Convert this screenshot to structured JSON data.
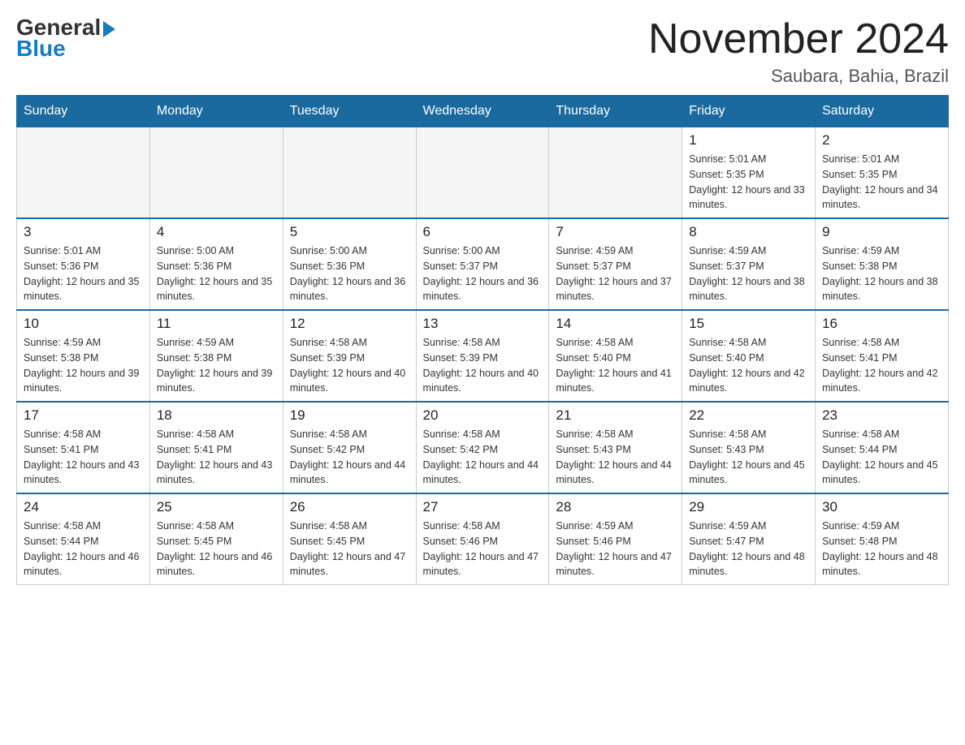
{
  "header": {
    "logo_general": "General",
    "logo_blue": "Blue",
    "title": "November 2024",
    "location": "Saubara, Bahia, Brazil"
  },
  "days_of_week": [
    "Sunday",
    "Monday",
    "Tuesday",
    "Wednesday",
    "Thursday",
    "Friday",
    "Saturday"
  ],
  "weeks": [
    [
      {
        "day": "",
        "sunrise": "",
        "sunset": "",
        "daylight": ""
      },
      {
        "day": "",
        "sunrise": "",
        "sunset": "",
        "daylight": ""
      },
      {
        "day": "",
        "sunrise": "",
        "sunset": "",
        "daylight": ""
      },
      {
        "day": "",
        "sunrise": "",
        "sunset": "",
        "daylight": ""
      },
      {
        "day": "",
        "sunrise": "",
        "sunset": "",
        "daylight": ""
      },
      {
        "day": "1",
        "sunrise": "Sunrise: 5:01 AM",
        "sunset": "Sunset: 5:35 PM",
        "daylight": "Daylight: 12 hours and 33 minutes."
      },
      {
        "day": "2",
        "sunrise": "Sunrise: 5:01 AM",
        "sunset": "Sunset: 5:35 PM",
        "daylight": "Daylight: 12 hours and 34 minutes."
      }
    ],
    [
      {
        "day": "3",
        "sunrise": "Sunrise: 5:01 AM",
        "sunset": "Sunset: 5:36 PM",
        "daylight": "Daylight: 12 hours and 35 minutes."
      },
      {
        "day": "4",
        "sunrise": "Sunrise: 5:00 AM",
        "sunset": "Sunset: 5:36 PM",
        "daylight": "Daylight: 12 hours and 35 minutes."
      },
      {
        "day": "5",
        "sunrise": "Sunrise: 5:00 AM",
        "sunset": "Sunset: 5:36 PM",
        "daylight": "Daylight: 12 hours and 36 minutes."
      },
      {
        "day": "6",
        "sunrise": "Sunrise: 5:00 AM",
        "sunset": "Sunset: 5:37 PM",
        "daylight": "Daylight: 12 hours and 36 minutes."
      },
      {
        "day": "7",
        "sunrise": "Sunrise: 4:59 AM",
        "sunset": "Sunset: 5:37 PM",
        "daylight": "Daylight: 12 hours and 37 minutes."
      },
      {
        "day": "8",
        "sunrise": "Sunrise: 4:59 AM",
        "sunset": "Sunset: 5:37 PM",
        "daylight": "Daylight: 12 hours and 38 minutes."
      },
      {
        "day": "9",
        "sunrise": "Sunrise: 4:59 AM",
        "sunset": "Sunset: 5:38 PM",
        "daylight": "Daylight: 12 hours and 38 minutes."
      }
    ],
    [
      {
        "day": "10",
        "sunrise": "Sunrise: 4:59 AM",
        "sunset": "Sunset: 5:38 PM",
        "daylight": "Daylight: 12 hours and 39 minutes."
      },
      {
        "day": "11",
        "sunrise": "Sunrise: 4:59 AM",
        "sunset": "Sunset: 5:38 PM",
        "daylight": "Daylight: 12 hours and 39 minutes."
      },
      {
        "day": "12",
        "sunrise": "Sunrise: 4:58 AM",
        "sunset": "Sunset: 5:39 PM",
        "daylight": "Daylight: 12 hours and 40 minutes."
      },
      {
        "day": "13",
        "sunrise": "Sunrise: 4:58 AM",
        "sunset": "Sunset: 5:39 PM",
        "daylight": "Daylight: 12 hours and 40 minutes."
      },
      {
        "day": "14",
        "sunrise": "Sunrise: 4:58 AM",
        "sunset": "Sunset: 5:40 PM",
        "daylight": "Daylight: 12 hours and 41 minutes."
      },
      {
        "day": "15",
        "sunrise": "Sunrise: 4:58 AM",
        "sunset": "Sunset: 5:40 PM",
        "daylight": "Daylight: 12 hours and 42 minutes."
      },
      {
        "day": "16",
        "sunrise": "Sunrise: 4:58 AM",
        "sunset": "Sunset: 5:41 PM",
        "daylight": "Daylight: 12 hours and 42 minutes."
      }
    ],
    [
      {
        "day": "17",
        "sunrise": "Sunrise: 4:58 AM",
        "sunset": "Sunset: 5:41 PM",
        "daylight": "Daylight: 12 hours and 43 minutes."
      },
      {
        "day": "18",
        "sunrise": "Sunrise: 4:58 AM",
        "sunset": "Sunset: 5:41 PM",
        "daylight": "Daylight: 12 hours and 43 minutes."
      },
      {
        "day": "19",
        "sunrise": "Sunrise: 4:58 AM",
        "sunset": "Sunset: 5:42 PM",
        "daylight": "Daylight: 12 hours and 44 minutes."
      },
      {
        "day": "20",
        "sunrise": "Sunrise: 4:58 AM",
        "sunset": "Sunset: 5:42 PM",
        "daylight": "Daylight: 12 hours and 44 minutes."
      },
      {
        "day": "21",
        "sunrise": "Sunrise: 4:58 AM",
        "sunset": "Sunset: 5:43 PM",
        "daylight": "Daylight: 12 hours and 44 minutes."
      },
      {
        "day": "22",
        "sunrise": "Sunrise: 4:58 AM",
        "sunset": "Sunset: 5:43 PM",
        "daylight": "Daylight: 12 hours and 45 minutes."
      },
      {
        "day": "23",
        "sunrise": "Sunrise: 4:58 AM",
        "sunset": "Sunset: 5:44 PM",
        "daylight": "Daylight: 12 hours and 45 minutes."
      }
    ],
    [
      {
        "day": "24",
        "sunrise": "Sunrise: 4:58 AM",
        "sunset": "Sunset: 5:44 PM",
        "daylight": "Daylight: 12 hours and 46 minutes."
      },
      {
        "day": "25",
        "sunrise": "Sunrise: 4:58 AM",
        "sunset": "Sunset: 5:45 PM",
        "daylight": "Daylight: 12 hours and 46 minutes."
      },
      {
        "day": "26",
        "sunrise": "Sunrise: 4:58 AM",
        "sunset": "Sunset: 5:45 PM",
        "daylight": "Daylight: 12 hours and 47 minutes."
      },
      {
        "day": "27",
        "sunrise": "Sunrise: 4:58 AM",
        "sunset": "Sunset: 5:46 PM",
        "daylight": "Daylight: 12 hours and 47 minutes."
      },
      {
        "day": "28",
        "sunrise": "Sunrise: 4:59 AM",
        "sunset": "Sunset: 5:46 PM",
        "daylight": "Daylight: 12 hours and 47 minutes."
      },
      {
        "day": "29",
        "sunrise": "Sunrise: 4:59 AM",
        "sunset": "Sunset: 5:47 PM",
        "daylight": "Daylight: 12 hours and 48 minutes."
      },
      {
        "day": "30",
        "sunrise": "Sunrise: 4:59 AM",
        "sunset": "Sunset: 5:48 PM",
        "daylight": "Daylight: 12 hours and 48 minutes."
      }
    ]
  ]
}
